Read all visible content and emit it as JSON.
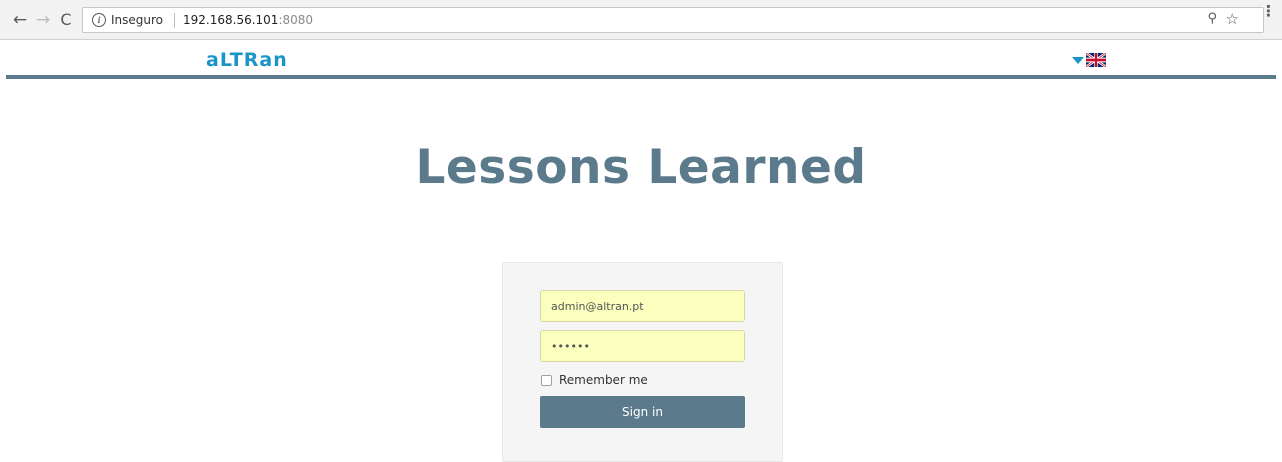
{
  "browser": {
    "back_icon": "←",
    "forward_icon": "→",
    "reload_icon": "C",
    "info_icon": "i",
    "security_label": "Inseguro",
    "url_host": "192.168.56.101",
    "url_port": ":8080",
    "key_icon": "⚲",
    "star_icon": "☆",
    "menu_icon": "⋮"
  },
  "header": {
    "logo_text": "aLTRan",
    "brand_color": "#1b94c8",
    "language_flag": "uk-flag-icon"
  },
  "main": {
    "title": "Lessons Learned",
    "accent_color": "#5b7b8c"
  },
  "login": {
    "email_value": "admin@altran.pt",
    "password_value": "••••••",
    "remember_label": "Remember me",
    "sign_in_label": "Sign in"
  }
}
